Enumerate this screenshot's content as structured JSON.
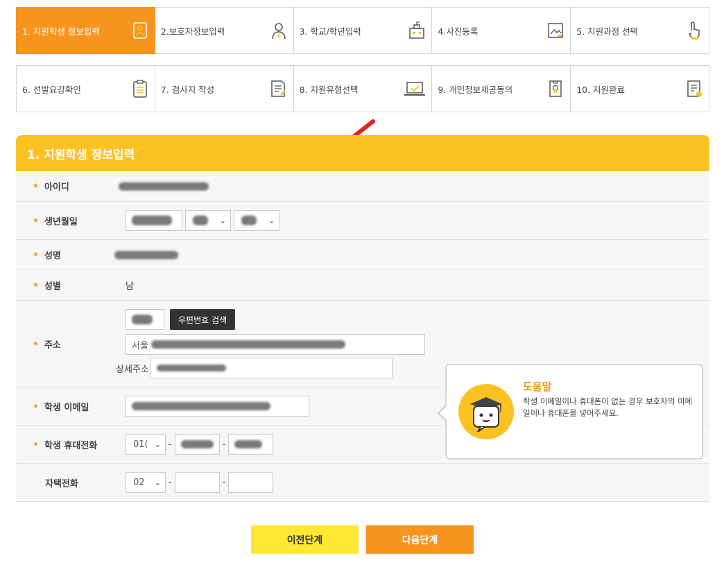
{
  "steps": [
    {
      "label": "1. 지원학생 정보입력",
      "icon": "id-card-icon",
      "active": true
    },
    {
      "label": "2.보호자정보입력",
      "icon": "person-icon"
    },
    {
      "label": "3. 학교/학년입력",
      "icon": "school-icon"
    },
    {
      "label": "4.사진등록",
      "icon": "photo-icon"
    },
    {
      "label": "5. 지원과정 선택",
      "icon": "pointer-hand-icon"
    },
    {
      "label": "6. 선발요강확인",
      "icon": "clipboard-icon"
    },
    {
      "label": "7. 검사지 작성",
      "icon": "document-edit-icon"
    },
    {
      "label": "8. 지원유형선택",
      "icon": "laptop-check-icon"
    },
    {
      "label": "9. 개인정보제공동의",
      "icon": "certificate-icon"
    },
    {
      "label": "10. 지원완료",
      "icon": "document-check-icon"
    }
  ],
  "panel": {
    "title": "1. 지원학생 정보입력"
  },
  "form": {
    "id_label": "아이디",
    "birth_label": "생년월일",
    "name_label": "성명",
    "gender_label": "성별",
    "gender_value": "남",
    "address_label": "주소",
    "address_prefix": "서울",
    "zip_search_label": "우편번호 검색",
    "detail_addr_label": "상세주소",
    "email_label": "학생 이메일",
    "mobile_label": "학생 휴대전화",
    "mobile_prefix": "01(",
    "home_label": "자택전화",
    "home_prefix": "02",
    "dash": "-"
  },
  "help": {
    "title": "도움말",
    "text": "학생 이메일이나 휴대폰이 없는 경우 보호자의 이메일이나 휴대폰을 넣어주세요."
  },
  "buttons": {
    "prev": "이전단계",
    "next": "다음단계"
  },
  "colors": {
    "accent": "#f7941d",
    "header": "#fcc223",
    "prev_button": "#ffe833",
    "arrow": "#e02020"
  }
}
